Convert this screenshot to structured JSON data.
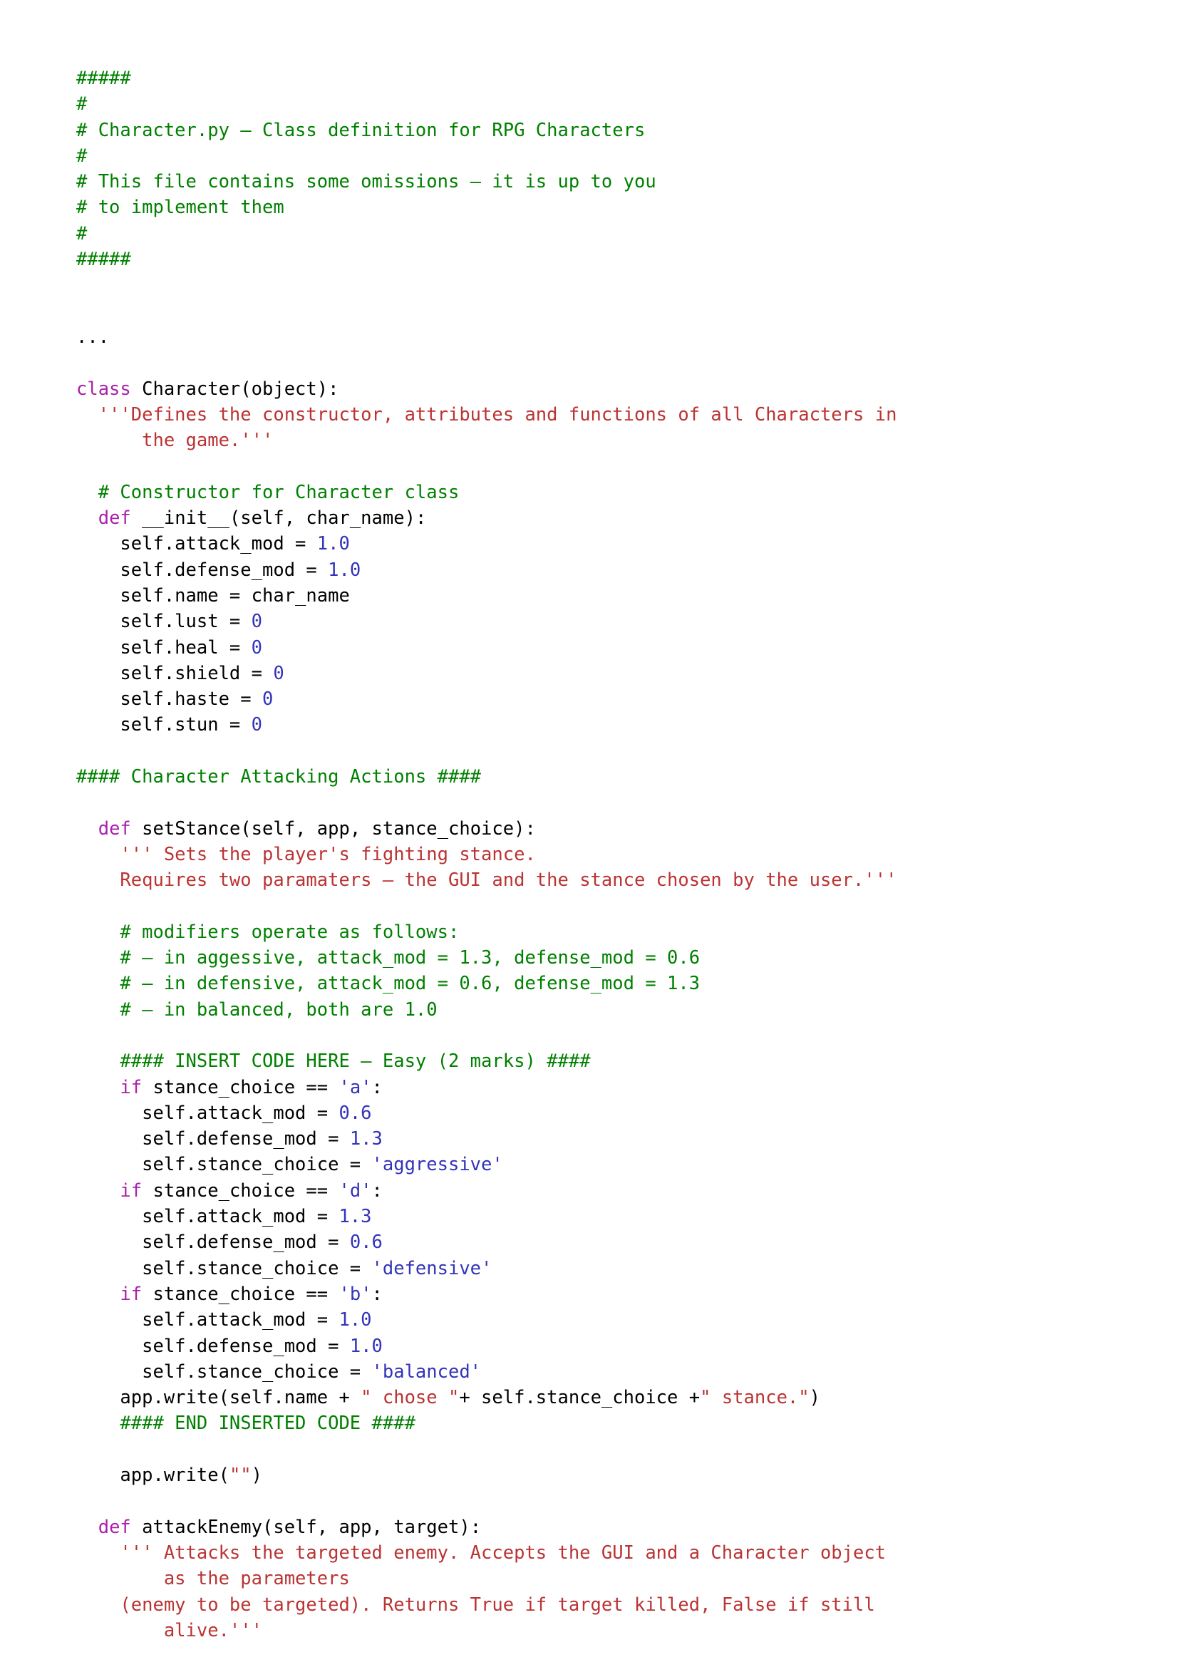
{
  "document": {
    "filename": "Character.py",
    "language": "python",
    "background_color": "#ffffff",
    "colors": {
      "comment": "#008000",
      "keyword": "#aa22aa",
      "number": "#3333bb",
      "single_quoted_string": "#3333bb",
      "double_quoted_string": "#bb3333",
      "docstring": "#bb3333",
      "plain_text": "#000000"
    }
  },
  "code": {
    "lines": [
      {
        "id": "l1",
        "text": "#####",
        "tokens": [
          {
            "t": "#####",
            "c": "c"
          }
        ]
      },
      {
        "id": "l2",
        "text": "#",
        "tokens": [
          {
            "t": "#",
            "c": "c"
          }
        ]
      },
      {
        "id": "l3",
        "text": "# Character.py - Class definition for RPG Characters",
        "tokens": [
          {
            "t": "# Character.py – Class definition for RPG Characters",
            "c": "c"
          }
        ]
      },
      {
        "id": "l4",
        "text": "#",
        "tokens": [
          {
            "t": "#",
            "c": "c"
          }
        ]
      },
      {
        "id": "l5",
        "text": "# This file contains some omissions - it is up to you",
        "tokens": [
          {
            "t": "# This file contains some omissions – it is up to you",
            "c": "c"
          }
        ]
      },
      {
        "id": "l6",
        "text": "# to implement them",
        "tokens": [
          {
            "t": "# to implement them",
            "c": "c"
          }
        ]
      },
      {
        "id": "l7",
        "text": "#",
        "tokens": [
          {
            "t": "#",
            "c": "c"
          }
        ]
      },
      {
        "id": "l8",
        "text": "#####",
        "tokens": [
          {
            "t": "#####",
            "c": "c"
          }
        ]
      },
      {
        "id": "l9",
        "text": "",
        "tokens": []
      },
      {
        "id": "l10",
        "text": "",
        "tokens": []
      },
      {
        "id": "l11",
        "text": "...",
        "tokens": [
          {
            "t": "...",
            "c": "p"
          }
        ]
      },
      {
        "id": "l12",
        "text": "",
        "tokens": []
      },
      {
        "id": "l13",
        "text": "class Character(object):",
        "tokens": [
          {
            "t": "class",
            "c": "k"
          },
          {
            "t": " Character(object):",
            "c": "p"
          }
        ]
      },
      {
        "id": "l14",
        "text": "  '''Defines the constructor, attributes and functions of all Characters in",
        "tokens": [
          {
            "t": "  '''Defines the constructor, attributes and functions of all Characters in",
            "c": "ds"
          }
        ]
      },
      {
        "id": "l15",
        "text": "      the game.'''",
        "tokens": [
          {
            "t": "      the game.'''",
            "c": "ds"
          }
        ]
      },
      {
        "id": "l16",
        "text": "",
        "tokens": []
      },
      {
        "id": "l17",
        "text": "  # Constructor for Character class",
        "tokens": [
          {
            "t": "  # Constructor for Character class",
            "c": "c"
          }
        ]
      },
      {
        "id": "l18",
        "text": "  def __init__(self, char_name):",
        "tokens": [
          {
            "t": "  ",
            "c": "p"
          },
          {
            "t": "def",
            "c": "k"
          },
          {
            "t": " __init__(self, char_name):",
            "c": "p"
          }
        ]
      },
      {
        "id": "l19",
        "text": "    self.attack_mod = 1.0",
        "tokens": [
          {
            "t": "    self.attack_mod = ",
            "c": "p"
          },
          {
            "t": "1.0",
            "c": "n"
          }
        ]
      },
      {
        "id": "l20",
        "text": "    self.defense_mod = 1.0",
        "tokens": [
          {
            "t": "    self.defense_mod = ",
            "c": "p"
          },
          {
            "t": "1.0",
            "c": "n"
          }
        ]
      },
      {
        "id": "l21",
        "text": "    self.name = char_name",
        "tokens": [
          {
            "t": "    self.name = char_name",
            "c": "p"
          }
        ]
      },
      {
        "id": "l22",
        "text": "    self.lust = 0",
        "tokens": [
          {
            "t": "    self.lust = ",
            "c": "p"
          },
          {
            "t": "0",
            "c": "n"
          }
        ]
      },
      {
        "id": "l23",
        "text": "    self.heal = 0",
        "tokens": [
          {
            "t": "    self.heal = ",
            "c": "p"
          },
          {
            "t": "0",
            "c": "n"
          }
        ]
      },
      {
        "id": "l24",
        "text": "    self.shield = 0",
        "tokens": [
          {
            "t": "    self.shield = ",
            "c": "p"
          },
          {
            "t": "0",
            "c": "n"
          }
        ]
      },
      {
        "id": "l25",
        "text": "    self.haste = 0",
        "tokens": [
          {
            "t": "    self.haste = ",
            "c": "p"
          },
          {
            "t": "0",
            "c": "n"
          }
        ]
      },
      {
        "id": "l26",
        "text": "    self.stun = 0",
        "tokens": [
          {
            "t": "    self.stun = ",
            "c": "p"
          },
          {
            "t": "0",
            "c": "n"
          }
        ]
      },
      {
        "id": "l27",
        "text": "",
        "tokens": []
      },
      {
        "id": "l28",
        "text": "#### Character Attacking Actions ####",
        "tokens": [
          {
            "t": "#### Character Attacking Actions ####",
            "c": "c"
          }
        ]
      },
      {
        "id": "l29",
        "text": "",
        "tokens": []
      },
      {
        "id": "l30",
        "text": "  def setStance(self, app, stance_choice):",
        "tokens": [
          {
            "t": "  ",
            "c": "p"
          },
          {
            "t": "def",
            "c": "k"
          },
          {
            "t": " setStance(self, app, stance_choice):",
            "c": "p"
          }
        ]
      },
      {
        "id": "l31",
        "text": "    ''' Sets the player's fighting stance.",
        "tokens": [
          {
            "t": "    ''' Sets the player's fighting stance.",
            "c": "ds"
          }
        ]
      },
      {
        "id": "l32",
        "text": "    Requires two paramaters - the GUI and the stance chosen by the user.'''",
        "tokens": [
          {
            "t": "    Requires two paramaters – the GUI and the stance chosen by the user.'''",
            "c": "ds"
          }
        ]
      },
      {
        "id": "l33",
        "text": "",
        "tokens": []
      },
      {
        "id": "l34",
        "text": "    # modifiers operate as follows:",
        "tokens": [
          {
            "t": "    # modifiers operate as follows:",
            "c": "c"
          }
        ]
      },
      {
        "id": "l35",
        "text": "    # - in aggessive, attack_mod = 1.3, defense_mod = 0.6",
        "tokens": [
          {
            "t": "    # – in aggessive, attack_mod = 1.3, defense_mod = 0.6",
            "c": "c"
          }
        ]
      },
      {
        "id": "l36",
        "text": "    # - in defensive, attack_mod = 0.6, defense_mod = 1.3",
        "tokens": [
          {
            "t": "    # – in defensive, attack_mod = 0.6, defense_mod = 1.3",
            "c": "c"
          }
        ]
      },
      {
        "id": "l37",
        "text": "    # - in balanced, both are 1.0",
        "tokens": [
          {
            "t": "    # – in balanced, both are 1.0",
            "c": "c"
          }
        ]
      },
      {
        "id": "l38",
        "text": "",
        "tokens": []
      },
      {
        "id": "l39",
        "text": "    #### INSERT CODE HERE - Easy (2 marks) ####",
        "tokens": [
          {
            "t": "    #### INSERT CODE HERE – Easy (2 marks) ####",
            "c": "c"
          }
        ]
      },
      {
        "id": "l40",
        "text": "    if stance_choice == 'a':",
        "tokens": [
          {
            "t": "    ",
            "c": "p"
          },
          {
            "t": "if",
            "c": "k"
          },
          {
            "t": " stance_choice == ",
            "c": "p"
          },
          {
            "t": "'a'",
            "c": "s1"
          },
          {
            "t": ":",
            "c": "p"
          }
        ]
      },
      {
        "id": "l41",
        "text": "      self.attack_mod = 0.6",
        "tokens": [
          {
            "t": "      self.attack_mod = ",
            "c": "p"
          },
          {
            "t": "0.6",
            "c": "n"
          }
        ]
      },
      {
        "id": "l42",
        "text": "      self.defense_mod = 1.3",
        "tokens": [
          {
            "t": "      self.defense_mod = ",
            "c": "p"
          },
          {
            "t": "1.3",
            "c": "n"
          }
        ]
      },
      {
        "id": "l43",
        "text": "      self.stance_choice = 'aggressive'",
        "tokens": [
          {
            "t": "      self.stance_choice = ",
            "c": "p"
          },
          {
            "t": "'aggressive'",
            "c": "s1"
          }
        ]
      },
      {
        "id": "l44",
        "text": "    if stance_choice == 'd':",
        "tokens": [
          {
            "t": "    ",
            "c": "p"
          },
          {
            "t": "if",
            "c": "k"
          },
          {
            "t": " stance_choice == ",
            "c": "p"
          },
          {
            "t": "'d'",
            "c": "s1"
          },
          {
            "t": ":",
            "c": "p"
          }
        ]
      },
      {
        "id": "l45",
        "text": "      self.attack_mod = 1.3",
        "tokens": [
          {
            "t": "      self.attack_mod = ",
            "c": "p"
          },
          {
            "t": "1.3",
            "c": "n"
          }
        ]
      },
      {
        "id": "l46",
        "text": "      self.defense_mod = 0.6",
        "tokens": [
          {
            "t": "      self.defense_mod = ",
            "c": "p"
          },
          {
            "t": "0.6",
            "c": "n"
          }
        ]
      },
      {
        "id": "l47",
        "text": "      self.stance_choice = 'defensive'",
        "tokens": [
          {
            "t": "      self.stance_choice = ",
            "c": "p"
          },
          {
            "t": "'defensive'",
            "c": "s1"
          }
        ]
      },
      {
        "id": "l48",
        "text": "    if stance_choice == 'b':",
        "tokens": [
          {
            "t": "    ",
            "c": "p"
          },
          {
            "t": "if",
            "c": "k"
          },
          {
            "t": " stance_choice == ",
            "c": "p"
          },
          {
            "t": "'b'",
            "c": "s1"
          },
          {
            "t": ":",
            "c": "p"
          }
        ]
      },
      {
        "id": "l49",
        "text": "      self.attack_mod = 1.0",
        "tokens": [
          {
            "t": "      self.attack_mod = ",
            "c": "p"
          },
          {
            "t": "1.0",
            "c": "n"
          }
        ]
      },
      {
        "id": "l50",
        "text": "      self.defense_mod = 1.0",
        "tokens": [
          {
            "t": "      self.defense_mod = ",
            "c": "p"
          },
          {
            "t": "1.0",
            "c": "n"
          }
        ]
      },
      {
        "id": "l51",
        "text": "      self.stance_choice = 'balanced'",
        "tokens": [
          {
            "t": "      self.stance_choice = ",
            "c": "p"
          },
          {
            "t": "'balanced'",
            "c": "s1"
          }
        ]
      },
      {
        "id": "l52",
        "text": "    app.write(self.name + \" chose \"+ self.stance_choice +\" stance.\")",
        "tokens": [
          {
            "t": "    app.write(self.name + ",
            "c": "p"
          },
          {
            "t": "\" chose \"",
            "c": "s2"
          },
          {
            "t": "+ self.stance_choice +",
            "c": "p"
          },
          {
            "t": "\" stance.\"",
            "c": "s2"
          },
          {
            "t": ")",
            "c": "p"
          }
        ]
      },
      {
        "id": "l53",
        "text": "    #### END INSERTED CODE ####",
        "tokens": [
          {
            "t": "    #### END INSERTED CODE ####",
            "c": "c"
          }
        ]
      },
      {
        "id": "l54",
        "text": "",
        "tokens": []
      },
      {
        "id": "l55",
        "text": "    app.write(\"\")",
        "tokens": [
          {
            "t": "    app.write(",
            "c": "p"
          },
          {
            "t": "\"\"",
            "c": "s2"
          },
          {
            "t": ")",
            "c": "p"
          }
        ]
      },
      {
        "id": "l56",
        "text": "",
        "tokens": []
      },
      {
        "id": "l57",
        "text": "  def attackEnemy(self, app, target):",
        "tokens": [
          {
            "t": "  ",
            "c": "p"
          },
          {
            "t": "def",
            "c": "k"
          },
          {
            "t": " attackEnemy(self, app, target):",
            "c": "p"
          }
        ]
      },
      {
        "id": "l58",
        "text": "    ''' Attacks the targeted enemy. Accepts the GUI and a Character object",
        "tokens": [
          {
            "t": "    ''' Attacks the targeted enemy. Accepts the GUI and a Character object",
            "c": "ds"
          }
        ]
      },
      {
        "id": "l59",
        "text": "        as the parameters",
        "tokens": [
          {
            "t": "        as the parameters",
            "c": "ds"
          }
        ]
      },
      {
        "id": "l60",
        "text": "    (enemy to be targeted). Returns True if target killed, False if still",
        "tokens": [
          {
            "t": "    (enemy to be targeted). Returns True if target killed, False if still",
            "c": "ds"
          }
        ]
      },
      {
        "id": "l61",
        "text": "        alive.'''",
        "tokens": [
          {
            "t": "        alive.'''",
            "c": "ds"
          }
        ]
      }
    ]
  }
}
